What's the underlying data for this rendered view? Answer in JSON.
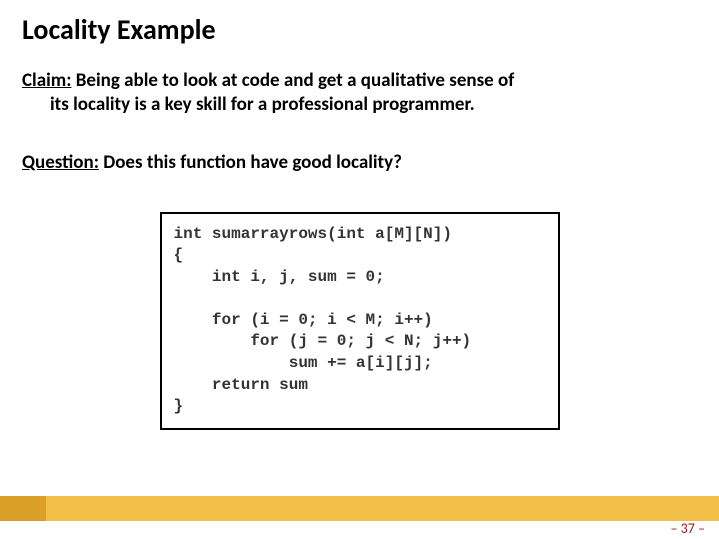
{
  "title": "Locality Example",
  "claim": {
    "label": "Claim:",
    "text_line1": " Being able to look at code and get a qualitative sense of",
    "text_line2": "its locality is a key skill for a professional programmer."
  },
  "question": {
    "label": "Question:",
    "text": " Does this function have good locality?"
  },
  "code": "int sumarrayrows(int a[M][N])\n{\n    int i, j, sum = 0;\n\n    for (i = 0; i < M; i++)\n        for (j = 0; j < N; j++)\n            sum += a[i][j];\n    return sum\n}",
  "page_number": "– 37 –",
  "colors": {
    "footer_dark": "#d99f27",
    "footer_light": "#f2bf49",
    "page_num": "#9b1c1c"
  }
}
